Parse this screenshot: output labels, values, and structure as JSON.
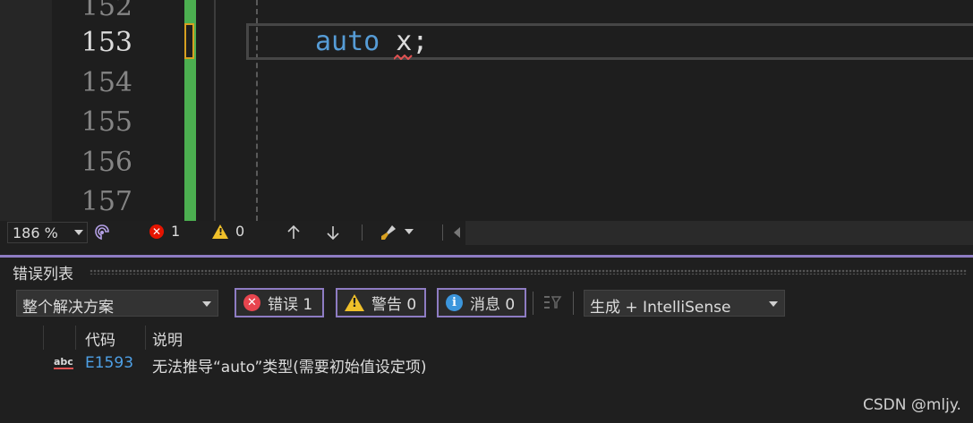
{
  "editor": {
    "line_numbers": [
      "152",
      "153",
      "154",
      "155",
      "156",
      "157"
    ],
    "code_keyword": "auto",
    "code_rest": " x;",
    "active_line": "153"
  },
  "status_bar": {
    "zoom": "186 %",
    "error_count": "1",
    "warning_count": "0"
  },
  "error_list": {
    "title": "错误列表",
    "scope": "整个解决方案",
    "errors_label": "错误 1",
    "warnings_label": "警告 0",
    "messages_label": "消息 0",
    "build_filter": "生成 + IntelliSense",
    "columns": [
      "代码",
      "说明"
    ],
    "rows": [
      {
        "code": "E1593",
        "description": "无法推导“auto”类型(需要初始值设定项)"
      }
    ]
  },
  "watermark": "CSDN @mljy.",
  "colors": {
    "accent": "#8e7cc3",
    "keyword": "#569cd6",
    "change_bar": "#4caf50",
    "error": "#e51400",
    "warning": "#f0c02a",
    "info": "#3c96dc"
  }
}
